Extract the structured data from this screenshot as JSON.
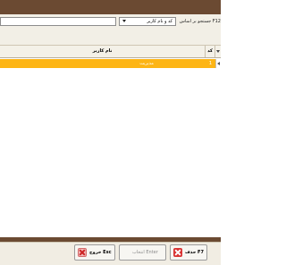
{
  "search": {
    "label": "F12 جستجو بر اساس",
    "field_value": "",
    "select_value": "کد و نام کاربر"
  },
  "grid": {
    "columns": {
      "code": "کد",
      "name": "نام کاربر"
    },
    "rows": [
      {
        "code": "1",
        "name": "مدیریت"
      }
    ],
    "selected_row_color": "#fdb515"
  },
  "footer": {
    "delete_label": "حذف F7",
    "select_label": "انتخاب Enter",
    "exit_label": "خروج Esc"
  },
  "colors": {
    "title_bar": "#6b4a32",
    "accent": "#fdb515"
  },
  "icons": {
    "delete": "delete-x-icon",
    "exit": "exit-x-icon",
    "dropdown": "chevron-down-icon",
    "sort": "sort-arrow-icon",
    "row_selector": "row-pointer-icon"
  }
}
